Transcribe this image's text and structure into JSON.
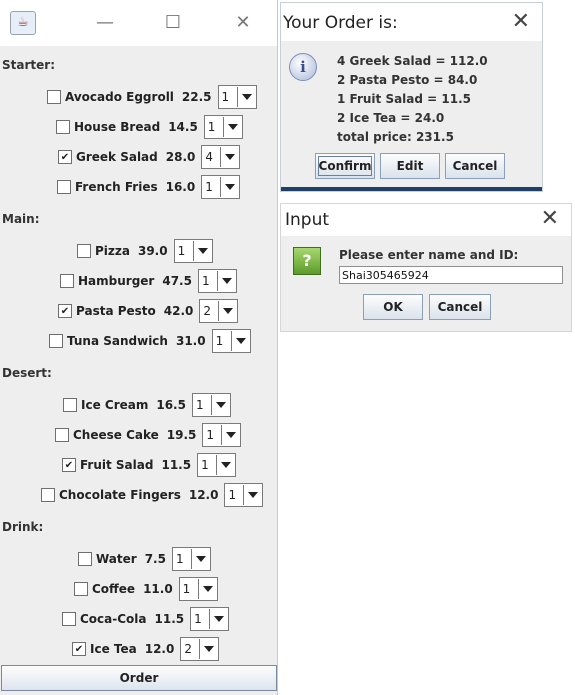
{
  "menu": {
    "sections": [
      {
        "label": "Starter:",
        "items": [
          {
            "name": "Avocado Eggroll",
            "price": "22.5",
            "qty": "1",
            "checked": false
          },
          {
            "name": "House Bread",
            "price": "14.5",
            "qty": "1",
            "checked": false
          },
          {
            "name": "Greek Salad",
            "price": "28.0",
            "qty": "4",
            "checked": true
          },
          {
            "name": "French Fries",
            "price": "16.0",
            "qty": "1",
            "checked": false
          }
        ]
      },
      {
        "label": "Main:",
        "items": [
          {
            "name": "Pizza",
            "price": "39.0",
            "qty": "1",
            "checked": false
          },
          {
            "name": "Hamburger",
            "price": "47.5",
            "qty": "1",
            "checked": false
          },
          {
            "name": "Pasta Pesto",
            "price": "42.0",
            "qty": "2",
            "checked": true
          },
          {
            "name": "Tuna Sandwich",
            "price": "31.0",
            "qty": "1",
            "checked": false
          }
        ]
      },
      {
        "label": "Desert:",
        "items": [
          {
            "name": "Ice Cream",
            "price": "16.5",
            "qty": "1",
            "checked": false
          },
          {
            "name": "Cheese Cake",
            "price": "19.5",
            "qty": "1",
            "checked": false
          },
          {
            "name": "Fruit Salad",
            "price": "11.5",
            "qty": "1",
            "checked": true
          },
          {
            "name": "Chocolate Fingers",
            "price": "12.0",
            "qty": "1",
            "checked": false
          }
        ]
      },
      {
        "label": "Drink:",
        "items": [
          {
            "name": "Water",
            "price": "7.5",
            "qty": "1",
            "checked": false
          },
          {
            "name": "Coffee",
            "price": "11.0",
            "qty": "1",
            "checked": false
          },
          {
            "name": "Coca-Cola",
            "price": "11.5",
            "qty": "1",
            "checked": false
          },
          {
            "name": "Ice Tea",
            "price": "12.0",
            "qty": "2",
            "checked": true
          }
        ]
      }
    ],
    "order_label": "Order"
  },
  "order_dialog": {
    "title": "Your Order is:",
    "lines": [
      "4 Greek Salad = 112.0",
      "2 Pasta Pesto = 84.0",
      "1 Fruit Salad = 11.5",
      "2 Ice Tea = 24.0",
      "total price: 231.5"
    ],
    "confirm_label": "Confirm",
    "edit_label": "Edit",
    "cancel_label": "Cancel"
  },
  "input_dialog": {
    "title": "Input",
    "prompt": "Please enter name and ID:",
    "value": "Shai305465924",
    "ok_label": "OK",
    "cancel_label": "Cancel"
  },
  "icons": {
    "app": "java-cup-icon",
    "info": "info-icon",
    "question": "question-icon"
  },
  "colors": {
    "window_bg": "#eeeeee",
    "titlebar_bg": "#ffffff",
    "question_icon": "#5d9b2b",
    "strip": "#1f3f66"
  }
}
